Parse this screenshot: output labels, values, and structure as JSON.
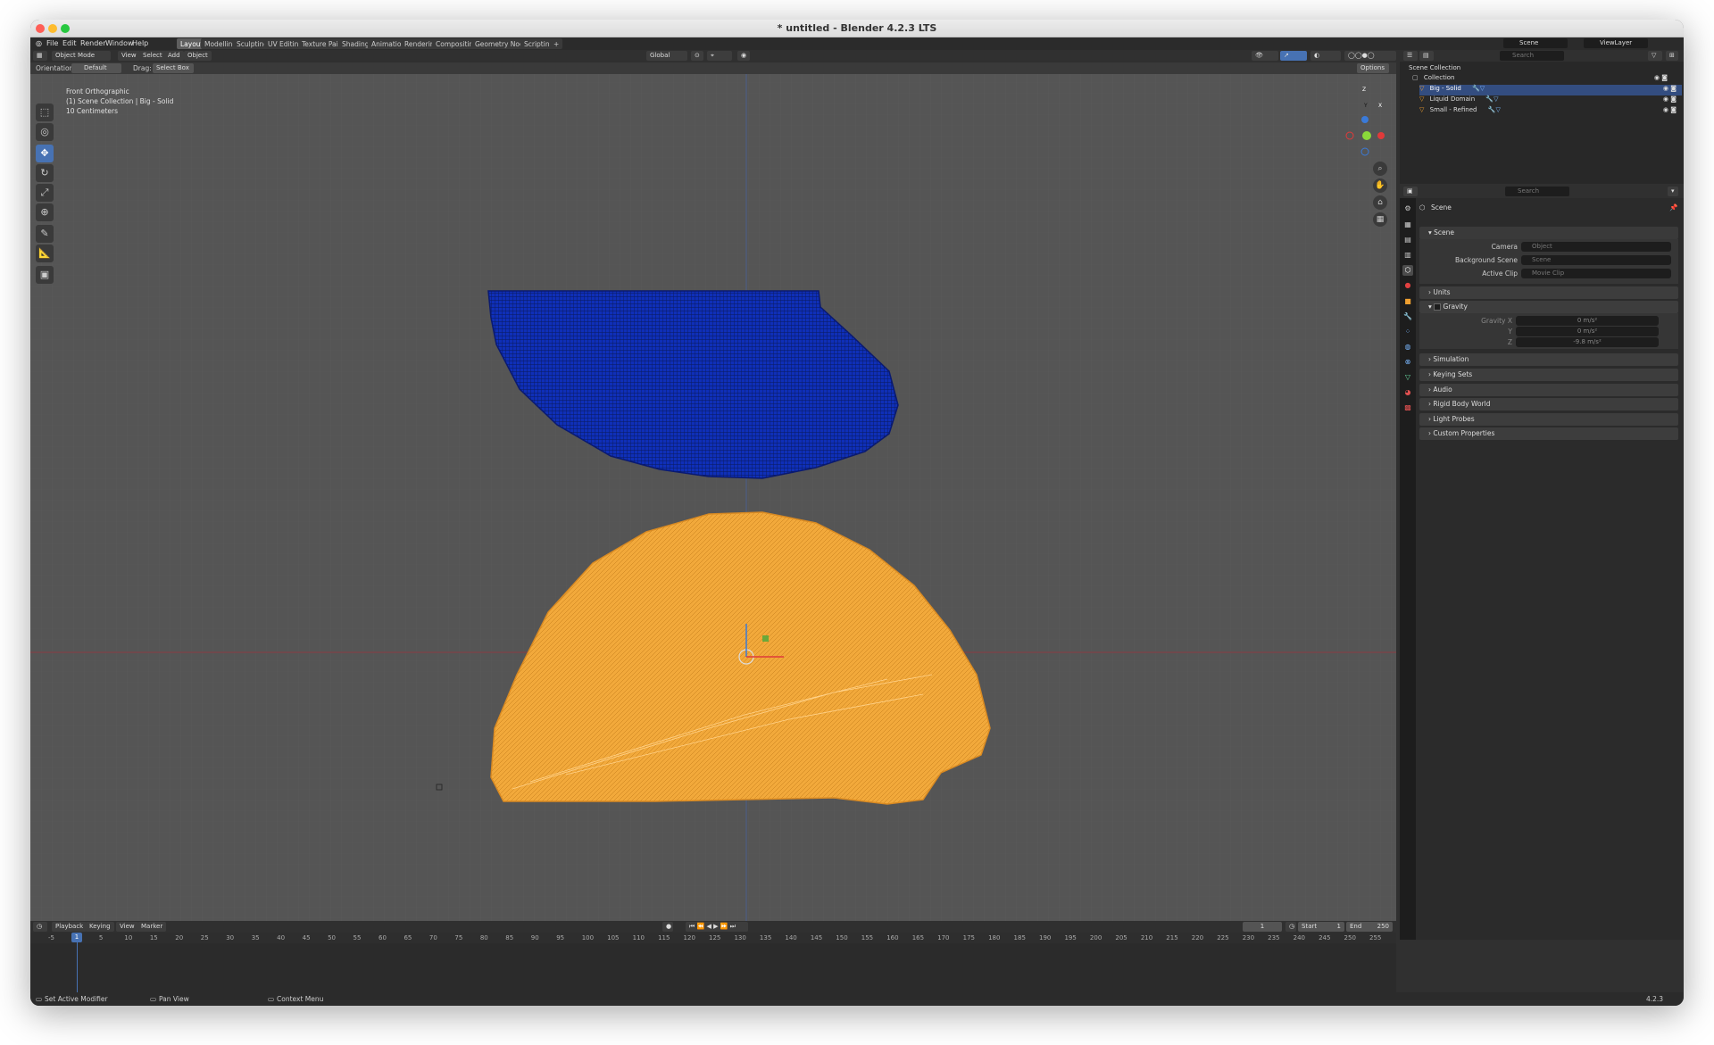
{
  "window": {
    "title": "* untitled - Blender 4.2.3 LTS"
  },
  "menu": {
    "items": [
      "File",
      "Edit",
      "Render",
      "Window",
      "Help"
    ]
  },
  "workspaces": {
    "tabs": [
      "Layout",
      "Modelling",
      "Sculpting",
      "UV Editing",
      "Texture Paint",
      "Shading",
      "Animation",
      "Rendering",
      "Compositing",
      "Geometry Nodes",
      "Scripting"
    ],
    "active": "Layout",
    "add": "+"
  },
  "topright": {
    "scene": "Scene",
    "view_layer": "ViewLayer"
  },
  "viewport": {
    "mode": "Object Mode",
    "menus": [
      "View",
      "Select",
      "Add",
      "Object"
    ],
    "transform_orientation": "Global",
    "orientation_label": "Orientation:",
    "orientation_value": "Default",
    "drag_label": "Drag:",
    "drag_value": "Select Box",
    "options": "Options",
    "overlay_line1": "Front Orthographic",
    "overlay_line2": "(1) Scene Collection | Big - Solid",
    "overlay_line3": "10 Centimeters",
    "gizmo": {
      "z": "Z",
      "y": "Y",
      "x": "X"
    }
  },
  "outliner": {
    "search_placeholder": "Search",
    "root": "Scene Collection",
    "collection": "Collection",
    "objects": [
      {
        "name": "Big - Solid",
        "selected": true
      },
      {
        "name": "Liquid Domain",
        "selected": false
      },
      {
        "name": "Small - Refined",
        "selected": false
      }
    ]
  },
  "properties": {
    "search_placeholder": "Search",
    "context": "Scene",
    "scene_section": "Scene",
    "camera_label": "Camera",
    "camera_placeholder": "Object",
    "bg_label": "Background Scene",
    "bg_placeholder": "Scene",
    "clip_label": "Active Clip",
    "clip_placeholder": "Movie Clip",
    "units": "Units",
    "gravity": "Gravity",
    "gravity_x_label": "Gravity X",
    "gravity_x": "0 m/s²",
    "gravity_y_label": "Y",
    "gravity_y": "0 m/s²",
    "gravity_z_label": "Z",
    "gravity_z": "-9.8 m/s²",
    "sections": [
      "Simulation",
      "Keying Sets",
      "Audio",
      "Rigid Body World",
      "Light Probes",
      "Custom Properties"
    ]
  },
  "timeline": {
    "menus": [
      "Playback",
      "Keying",
      "View",
      "Marker"
    ],
    "current_frame": "1",
    "start_label": "Start",
    "start": "1",
    "end_label": "End",
    "end": "250",
    "ticks": [
      "-5",
      "1",
      "5",
      "10",
      "15",
      "20",
      "25",
      "30",
      "35",
      "40",
      "45",
      "50",
      "55",
      "60",
      "65",
      "70",
      "75",
      "80",
      "85",
      "90",
      "95",
      "100",
      "105",
      "110",
      "115",
      "120",
      "125",
      "130",
      "135",
      "140",
      "145",
      "150",
      "155",
      "160",
      "165",
      "170",
      "175",
      "180",
      "185",
      "190",
      "195",
      "200",
      "205",
      "210",
      "215",
      "220",
      "225",
      "230",
      "235",
      "240",
      "245",
      "250",
      "255"
    ]
  },
  "statusbar": {
    "items": [
      "Set Active Modifier",
      "Pan View",
      "Context Menu"
    ],
    "version": "4.2.3"
  },
  "colors": {
    "accent": "#4772b3",
    "liquid": "#f0a030",
    "solid": "#1a3dd6",
    "viewport_bg": "#555555"
  }
}
